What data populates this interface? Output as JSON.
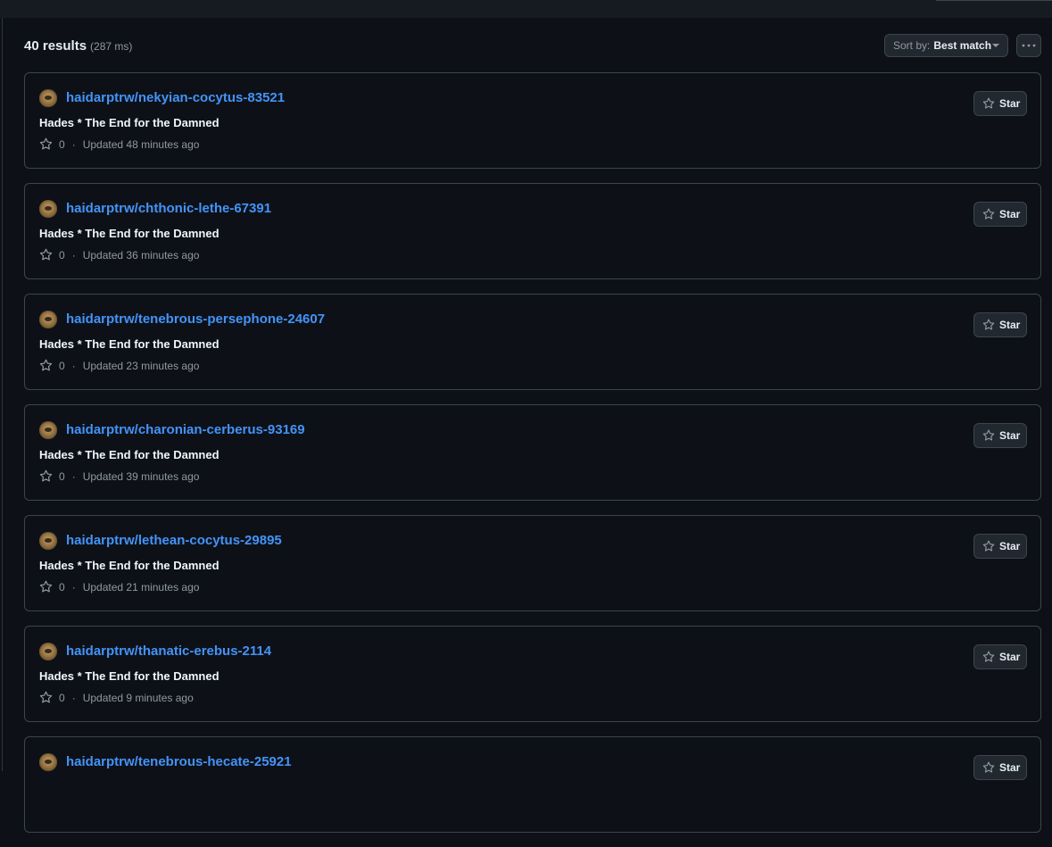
{
  "header": {
    "count_label": "40 results",
    "time_label": "(287 ms)",
    "sort_prefix": "Sort by:",
    "sort_value": "Best match",
    "more_icon": "kebab-horizontal-icon"
  },
  "colors": {
    "background": "#0d1117",
    "border": "#3d444d",
    "link": "#4493f8",
    "muted_text": "#9198a1",
    "button_bg": "#212830"
  },
  "results": [
    {
      "repo": "haidarptrw/nekyian-cocytus-83521",
      "description": "Hades * The End for the Damned",
      "stars": "0",
      "updated": "Updated 48 minutes ago",
      "star_label": "Star"
    },
    {
      "repo": "haidarptrw/chthonic-lethe-67391",
      "description": "Hades * The End for the Damned",
      "stars": "0",
      "updated": "Updated 36 minutes ago",
      "star_label": "Star"
    },
    {
      "repo": "haidarptrw/tenebrous-persephone-24607",
      "description": "Hades * The End for the Damned",
      "stars": "0",
      "updated": "Updated 23 minutes ago",
      "star_label": "Star"
    },
    {
      "repo": "haidarptrw/charonian-cerberus-93169",
      "description": "Hades * The End for the Damned",
      "stars": "0",
      "updated": "Updated 39 minutes ago",
      "star_label": "Star"
    },
    {
      "repo": "haidarptrw/lethean-cocytus-29895",
      "description": "Hades * The End for the Damned",
      "stars": "0",
      "updated": "Updated 21 minutes ago",
      "star_label": "Star"
    },
    {
      "repo": "haidarptrw/thanatic-erebus-2114",
      "description": "Hades * The End for the Damned",
      "stars": "0",
      "updated": "Updated 9 minutes ago",
      "star_label": "Star"
    },
    {
      "repo": "haidarptrw/tenebrous-hecate-25921",
      "description": "",
      "stars": "",
      "updated": "",
      "star_label": "Star"
    }
  ]
}
